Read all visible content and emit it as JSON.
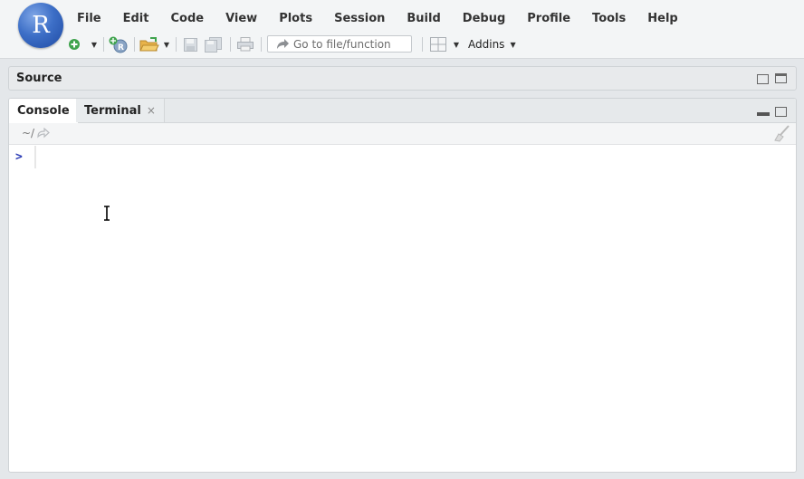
{
  "app": {
    "logo_letter": "R"
  },
  "menu": {
    "items": [
      "File",
      "Edit",
      "Code",
      "View",
      "Plots",
      "Session",
      "Build",
      "Debug",
      "Profile",
      "Tools",
      "Help"
    ]
  },
  "toolbar": {
    "goto_placeholder": "Go to file/function",
    "addins_label": "Addins",
    "icons": [
      "new-file-icon",
      "new-project-icon",
      "open-file-icon",
      "save-icon",
      "save-all-icon",
      "print-icon",
      "grid-layout-icon"
    ]
  },
  "source": {
    "title": "Source"
  },
  "console": {
    "tabs": [
      {
        "label": "Console",
        "active": true
      },
      {
        "label": "Terminal",
        "active": false,
        "close": "×"
      }
    ],
    "path": "~/",
    "prompt": ">"
  },
  "colors": {
    "accent": "#3d6fc7",
    "prompt": "#2b3bb5",
    "background": "#e4e7ea",
    "new_file_green": "#3fa34d",
    "open_folder": "#e8b34a"
  }
}
